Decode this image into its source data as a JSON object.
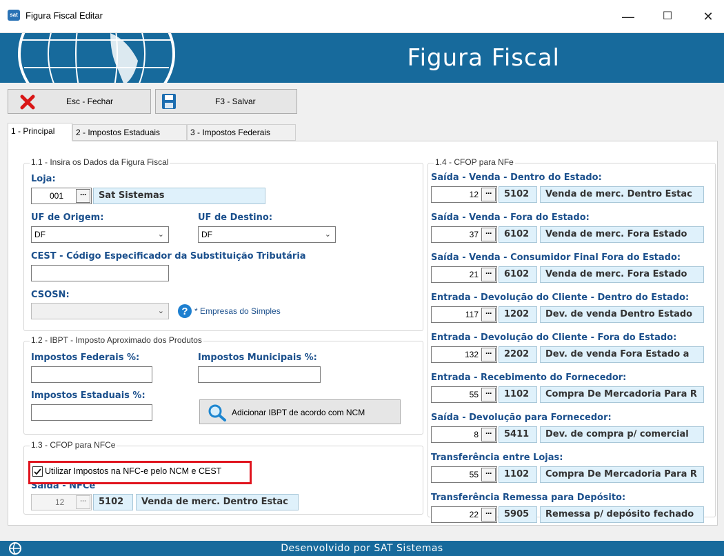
{
  "window": {
    "title": "Figura Fiscal Editar",
    "app_icon_text": "sat",
    "minimize": "—",
    "maximize": "☐",
    "close": "✕"
  },
  "header": {
    "title": "Figura Fiscal"
  },
  "toolbar": {
    "close_label": "Esc - Fechar",
    "save_label": "F3 - Salvar"
  },
  "tabs": [
    {
      "label": "1 - Principal",
      "active": true
    },
    {
      "label": "2 - Impostos Estaduais",
      "active": false
    },
    {
      "label": "3 - Impostos Federais",
      "active": false
    }
  ],
  "g11": {
    "legend": "1.1 - Insira os Dados da Figura Fiscal",
    "loja_label": "Loja:",
    "loja_code": "001",
    "loja_name": "Sat Sistemas",
    "uf_origem_label": "UF de Origem:",
    "uf_origem_value": "DF",
    "uf_destino_label": "UF de Destino:",
    "uf_destino_value": "DF",
    "cest_label": "CEST - Código Especificador da Substituição Tributária",
    "cest_value": "",
    "csosn_label": "CSOSN:",
    "csosn_value": "",
    "csosn_hint": "* Empresas do Simples"
  },
  "g12": {
    "legend": "1.2 - IBPT - Imposto Aproximado dos Produtos",
    "federais_label": "Impostos Federais %:",
    "municipais_label": "Impostos Municipais %:",
    "estaduais_label": "Impostos Estaduais %:",
    "add_button": "Adicionar IBPT de acordo com NCM"
  },
  "g13": {
    "legend": "1.3 - CFOP para NFCe",
    "checkbox_label": "Utilizar Impostos na NFC-e pelo NCM e CEST",
    "checkbox_checked": true,
    "saida_label": "Saída - NFCe",
    "code": "12",
    "cfop": "5102",
    "desc": "Venda de merc. Dentro Estac"
  },
  "g14": {
    "legend": "1.4 - CFOP para NFe",
    "rows": [
      {
        "label": "Saída - Venda - Dentro do Estado:",
        "code": "12",
        "cfop": "5102",
        "desc": "Venda de merc. Dentro Estac"
      },
      {
        "label": "Saída - Venda - Fora do Estado:",
        "code": "37",
        "cfop": "6102",
        "desc": "Venda de merc. Fora Estado"
      },
      {
        "label": "Saída - Venda - Consumidor Final Fora do Estado:",
        "code": "21",
        "cfop": "6102",
        "desc": "Venda de merc. Fora Estado"
      },
      {
        "label": "Entrada - Devolução do Cliente - Dentro do Estado:",
        "code": "117",
        "cfop": "1202",
        "desc": "Dev. de venda Dentro Estado"
      },
      {
        "label": "Entrada - Devolução do Cliente - Fora do Estado:",
        "code": "132",
        "cfop": "2202",
        "desc": "Dev. de venda Fora Estado a"
      },
      {
        "label": "Entrada - Recebimento do Fornecedor:",
        "code": "55",
        "cfop": "1102",
        "desc": "Compra De Mercadoria Para R"
      },
      {
        "label": "Saída - Devolução para Fornecedor:",
        "code": "8",
        "cfop": "5411",
        "desc": "Dev. de compra p/ comercial"
      },
      {
        "label": "Transferência entre Lojas:",
        "code": "55",
        "cfop": "1102",
        "desc": "Compra De Mercadoria Para R"
      },
      {
        "label": "Transferência Remessa para Depósito:",
        "code": "22",
        "cfop": "5905",
        "desc": "Remessa p/ depósito fechado"
      }
    ]
  },
  "footer": {
    "text": "Desenvolvido por SAT Sistemas"
  },
  "colors": {
    "brand": "#176a9c",
    "label_blue": "#1a4f8c",
    "highlight_red": "#e0141e",
    "readonly_bg": "#dff1fb"
  },
  "icons": [
    "close-x-icon",
    "save-disk-icon",
    "help-icon",
    "search-icon",
    "globe-icon"
  ]
}
